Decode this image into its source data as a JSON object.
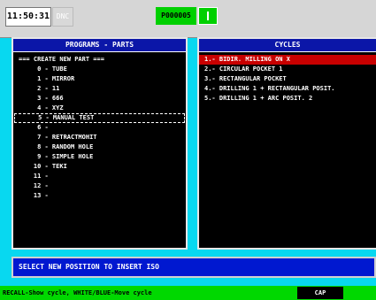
{
  "topbar": {
    "clock": "11:50:31",
    "mode": "DNC",
    "program": "P000005"
  },
  "programs_panel": {
    "title": "PROGRAMS - PARTS",
    "items": [
      "=== CREATE NEW PART ===",
      "     0 - TUBE",
      "     1 - MIRROR",
      "     2 - 11",
      "     3 - 666",
      "     4 - XYZ",
      "     5 - MANUAL TEST",
      "     6 -",
      "     7 - RETRACTMOHIT",
      "     8 - RANDOM HOLE",
      "     9 - SIMPLE HOLE",
      "    10 - TEKI",
      "    11 -",
      "    12 -",
      "    13 -"
    ],
    "selected_index": 6
  },
  "cycles_panel": {
    "title": "CYCLES",
    "items": [
      "1.- BIDIR. MILLING ON X",
      "2.- CIRCULAR POCKET 1",
      "3.- RECTANGULAR POCKET",
      "4.- DRILLING 1 + RECTANGULAR POSIT.",
      "5.- DRILLING 1 + ARC POSIT. 2"
    ],
    "highlighted_index": 0
  },
  "status": {
    "message": "SELECT NEW POSITION TO INSERT ISO"
  },
  "bottombar": {
    "hint": "RECALL-Show cycle, WHITE/BLUE-Move cycle",
    "cap": "CAP"
  },
  "colors": {
    "background": "#08d8f0",
    "panel_header": "#0b16a8",
    "highlight": "#c80000",
    "status": "#0018d0",
    "bottom": "#00d800"
  }
}
